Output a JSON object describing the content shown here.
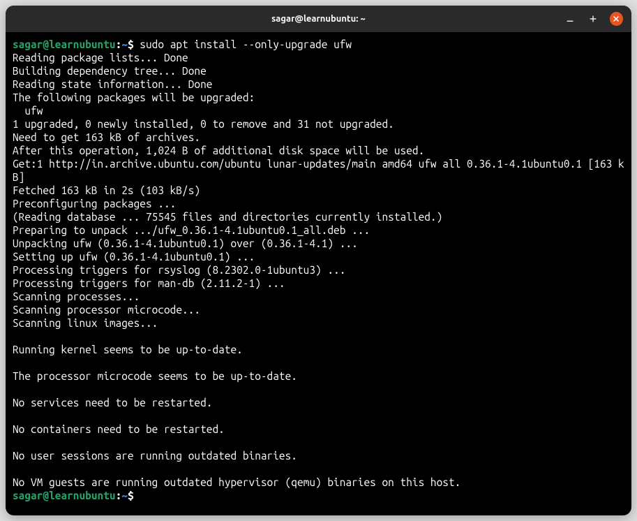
{
  "window": {
    "title": "sagar@learnubuntu: ~"
  },
  "prompt": {
    "user_host": "sagar@learnubuntu",
    "colon": ":",
    "path": "~",
    "dollar": "$"
  },
  "command": " sudo apt install --only-upgrade ufw",
  "output_lines": [
    "Reading package lists... Done",
    "Building dependency tree... Done",
    "Reading state information... Done",
    "The following packages will be upgraded:",
    "  ufw",
    "1 upgraded, 0 newly installed, 0 to remove and 31 not upgraded.",
    "Need to get 163 kB of archives.",
    "After this operation, 1,024 B of additional disk space will be used.",
    "Get:1 http://in.archive.ubuntu.com/ubuntu lunar-updates/main amd64 ufw all 0.36.1-4.1ubuntu0.1 [163 kB]",
    "Fetched 163 kB in 2s (103 kB/s)",
    "Preconfiguring packages ...",
    "(Reading database ... 75545 files and directories currently installed.)",
    "Preparing to unpack .../ufw_0.36.1-4.1ubuntu0.1_all.deb ...",
    "Unpacking ufw (0.36.1-4.1ubuntu0.1) over (0.36.1-4.1) ...",
    "Setting up ufw (0.36.1-4.1ubuntu0.1) ...",
    "Processing triggers for rsyslog (8.2302.0-1ubuntu3) ...",
    "Processing triggers for man-db (2.11.2-1) ...",
    "Scanning processes...",
    "Scanning processor microcode...",
    "Scanning linux images...",
    "",
    "Running kernel seems to be up-to-date.",
    "",
    "The processor microcode seems to be up-to-date.",
    "",
    "No services need to be restarted.",
    "",
    "No containers need to be restarted.",
    "",
    "No user sessions are running outdated binaries.",
    "",
    "No VM guests are running outdated hypervisor (qemu) binaries on this host."
  ]
}
